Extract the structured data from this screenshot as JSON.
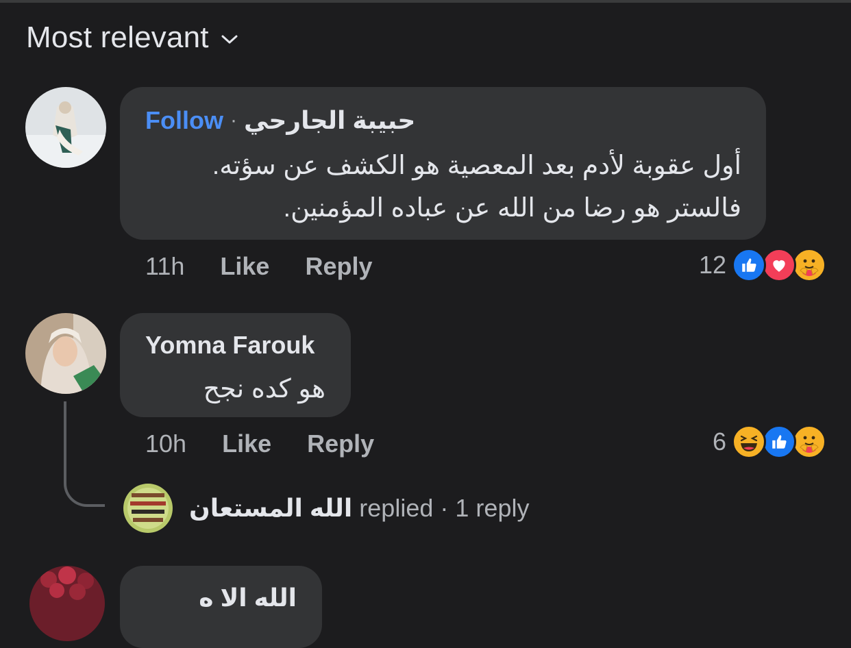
{
  "sort": {
    "label": "Most relevant"
  },
  "comments": [
    {
      "author": "حبيبة الجارحي",
      "follow": "Follow",
      "separator": "·",
      "lines": [
        "أول عقوبة لأدم بعد المعصية هو الكشف عن سؤته.",
        "فالستر هو رضا من الله عن عباده المؤمنين."
      ],
      "time": "11h",
      "like": "Like",
      "reply": "Reply",
      "reaction_count": "12",
      "reactions": [
        "like-icon",
        "love-icon",
        "care-icon"
      ]
    },
    {
      "author": "Yomna Farouk",
      "lines": [
        "هو كده نجح"
      ],
      "time": "10h",
      "like": "Like",
      "reply": "Reply",
      "reaction_count": "6",
      "reactions": [
        "haha-icon",
        "like-icon",
        "care-icon"
      ],
      "replies": {
        "author": "الله المستعان",
        "verb": "replied",
        "separator": "·",
        "count": "1 reply"
      }
    },
    {
      "author": "الله الا ه",
      "lines": []
    }
  ],
  "colors": {
    "background": "#1c1c1e",
    "bubble": "#333436",
    "follow": "#4b8ef5",
    "like": "#1877f2",
    "love": "#f33e58",
    "care": "#f7b125"
  }
}
